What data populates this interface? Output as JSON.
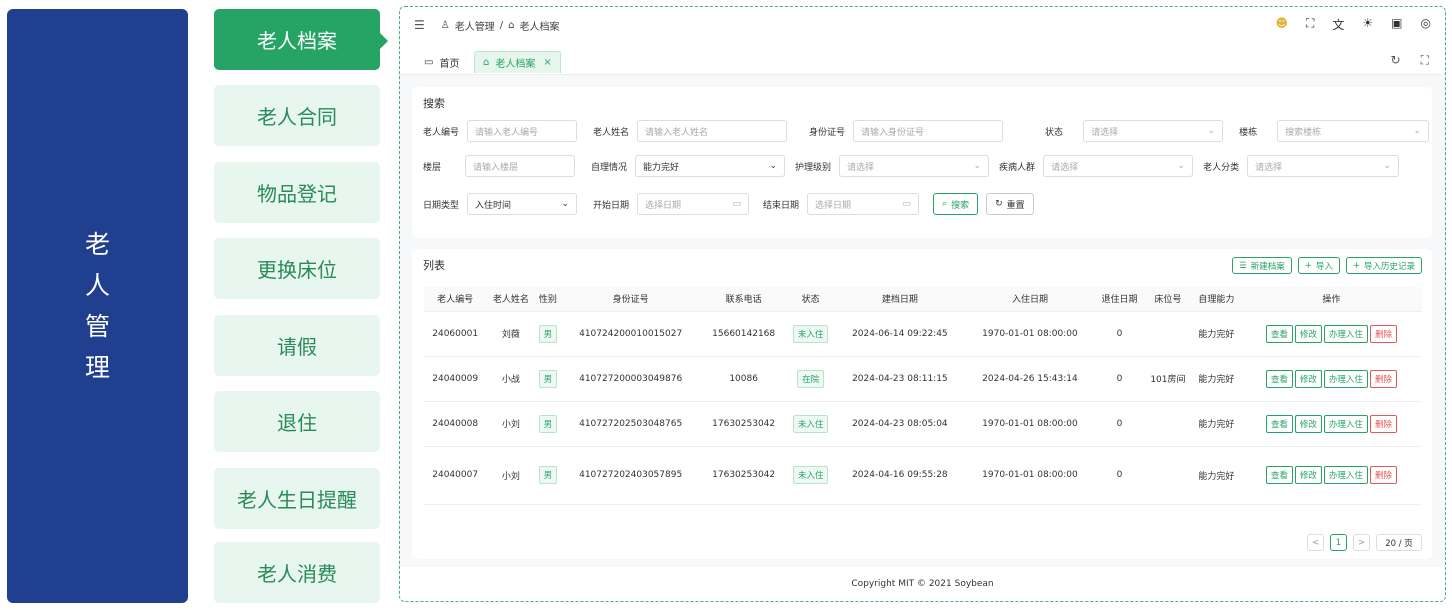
{
  "side_title": [
    "老",
    "人",
    "管",
    "理"
  ],
  "menu": {
    "items": [
      {
        "label": "老人档案"
      },
      {
        "label": "老人合同"
      },
      {
        "label": "物品登记"
      },
      {
        "label": "更换床位"
      },
      {
        "label": "请假"
      },
      {
        "label": "退住"
      },
      {
        "label": "老人生日提醒"
      },
      {
        "label": "老人消费"
      }
    ]
  },
  "breadcrumb": {
    "parent": "老人管理",
    "sep": "/",
    "current": "老人档案"
  },
  "tabs": {
    "home": "首页",
    "current": "老人档案",
    "close": "×"
  },
  "search": {
    "title": "搜索",
    "fields": {
      "elder_no": {
        "label": "老人编号",
        "placeholder": "请输入老人编号"
      },
      "elder_name": {
        "label": "老人姓名",
        "placeholder": "请输入老人姓名"
      },
      "id_no": {
        "label": "身份证号",
        "placeholder": "请输入身份证号"
      },
      "status": {
        "label": "状态",
        "placeholder": "请选择"
      },
      "building": {
        "label": "楼栋",
        "placeholder": "搜索楼栋"
      },
      "floor": {
        "label": "楼层",
        "placeholder": "请输入楼层"
      },
      "self_care": {
        "label": "自理情况",
        "value": "能力完好"
      },
      "care_level": {
        "label": "护理级别",
        "placeholder": "请选择"
      },
      "disease": {
        "label": "疾病人群",
        "placeholder": "请选择"
      },
      "category": {
        "label": "老人分类",
        "placeholder": "请选择"
      },
      "date_type": {
        "label": "日期类型",
        "value": "入住时间"
      },
      "start_date": {
        "label": "开始日期",
        "placeholder": "选择日期"
      },
      "end_date": {
        "label": "结束日期",
        "placeholder": "选择日期"
      }
    },
    "search_btn": "搜索",
    "reset_btn": "重置"
  },
  "list": {
    "title": "列表",
    "new_btn": "新建档案",
    "import_btn": "导入",
    "import_history_btn": "导入历史记录",
    "columns": [
      "老人编号",
      "老人姓名",
      "性别",
      "身份证号",
      "联系电话",
      "状态",
      "建档日期",
      "入住日期",
      "退住日期",
      "床位号",
      "自理能力",
      "操作"
    ],
    "rows": [
      {
        "no": "24060001",
        "name": "刘薇",
        "gender": "男",
        "id": "410724200010015027",
        "phone": "15660142168",
        "status": "未入住",
        "created": "2024-06-14 09:22:45",
        "checkin": "1970-01-01 08:00:00",
        "checkout": "0",
        "bed": "",
        "ability": "能力完好"
      },
      {
        "no": "24040009",
        "name": "小战",
        "gender": "男",
        "id": "410727200003049876",
        "phone": "10086",
        "status": "在院",
        "created": "2024-04-23 08:11:15",
        "checkin": "2024-04-26 15:43:14",
        "checkout": "0",
        "bed": "101房间",
        "ability": "能力完好"
      },
      {
        "no": "24040008",
        "name": "小刘",
        "gender": "男",
        "id": "410727202503048765",
        "phone": "17630253042",
        "status": "未入住",
        "created": "2024-04-23 08:05:04",
        "checkin": "1970-01-01 08:00:00",
        "checkout": "0",
        "bed": "",
        "ability": "能力完好"
      },
      {
        "no": "24040007",
        "name": "小刘",
        "gender": "男",
        "id": "410727202403057895",
        "phone": "17630253042",
        "status": "未入住",
        "created": "2024-04-16 09:55:28",
        "checkin": "1970-01-01 08:00:00",
        "checkout": "0",
        "bed": "",
        "ability": "能力完好"
      }
    ],
    "ops": {
      "view": "查看",
      "edit": "修改",
      "checkin": "办理入住",
      "delete": "删除"
    }
  },
  "pager": {
    "prev": "<",
    "page": "1",
    "next": ">",
    "size": "20 / 页"
  },
  "footer": "Copyright MIT © 2021 Soybean"
}
